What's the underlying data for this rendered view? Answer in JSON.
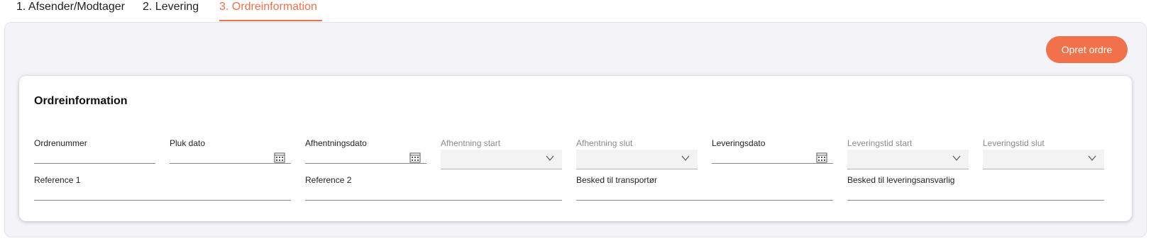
{
  "tabs": [
    {
      "label": "1. Afsender/Modtager"
    },
    {
      "label": "2. Levering"
    },
    {
      "label": "3. Ordreinformation"
    }
  ],
  "actions": {
    "create_order": "Opret ordre"
  },
  "card": {
    "title": "Ordreinformation"
  },
  "fields": {
    "ordrenummer": {
      "label": "Ordrenummer",
      "value": ""
    },
    "pluk_dato": {
      "label": "Pluk dato",
      "value": ""
    },
    "afhentningsdato": {
      "label": "Afhentningsdato",
      "value": ""
    },
    "afhentning_start": {
      "label": "Afhentning start",
      "value": ""
    },
    "afhentning_slut": {
      "label": "Afhentning slut",
      "value": ""
    },
    "leveringsdato": {
      "label": "Leveringsdato",
      "value": ""
    },
    "leveringstid_start": {
      "label": "Leveringstid start",
      "value": ""
    },
    "leveringstid_slut": {
      "label": "Leveringstid slut",
      "value": ""
    },
    "reference_1": {
      "label": "Reference 1",
      "value": ""
    },
    "reference_2": {
      "label": "Reference 2",
      "value": ""
    },
    "besked_transportoer": {
      "label": "Besked til transportør",
      "value": ""
    },
    "besked_leveringsansvarlig": {
      "label": "Besked til leveringsansvarlig",
      "value": ""
    }
  },
  "colors": {
    "accent": "#f0714a",
    "panel_bg": "#f3f3f8",
    "disabled_select_bg": "#f3f3f3"
  },
  "icons": {
    "date": "calendar-icon",
    "dropdown": "chevron-down-icon"
  }
}
